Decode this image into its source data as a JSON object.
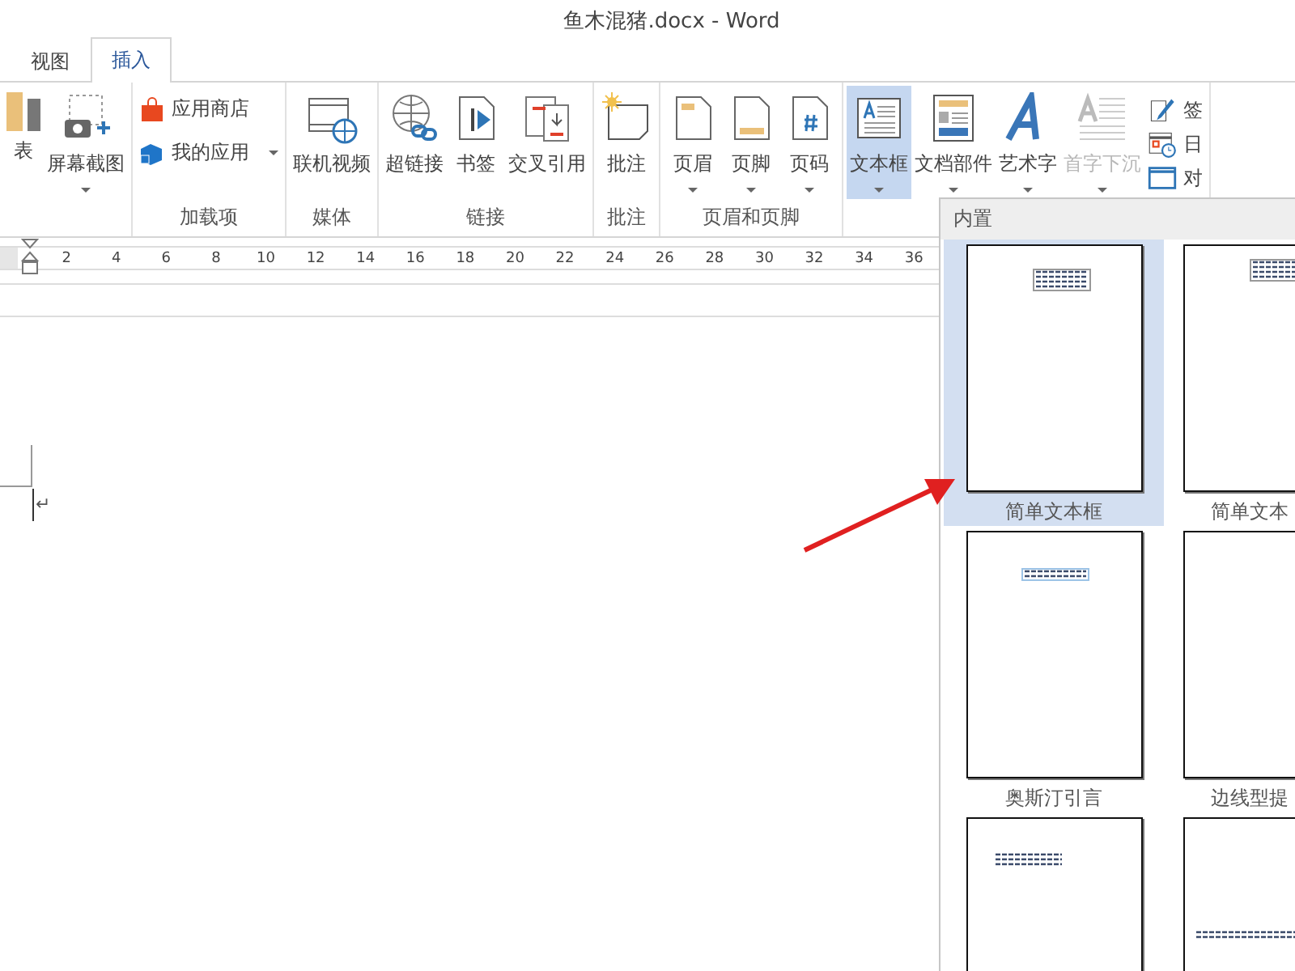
{
  "window": {
    "title": "鱼木混猪.docx - Word"
  },
  "tabs": [
    {
      "label": "视图",
      "selected": false
    },
    {
      "label": "插入",
      "selected": true
    }
  ],
  "ribbon": {
    "groups": [
      {
        "buttons": [
          {
            "kind": "large",
            "label": "表",
            "dropdown": false
          },
          {
            "kind": "large",
            "label": "屏幕截图",
            "dropdown": true
          }
        ]
      },
      {
        "label": "加载项",
        "buttons": [
          {
            "kind": "small",
            "label": "应用商店",
            "dropdown": false
          },
          {
            "kind": "small",
            "label": "我的应用",
            "dropdown": true
          }
        ]
      },
      {
        "label": "媒体",
        "buttons": [
          {
            "kind": "large",
            "label": "联机视频",
            "dropdown": false
          }
        ]
      },
      {
        "label": "链接",
        "buttons": [
          {
            "kind": "large",
            "label": "超链接",
            "dropdown": false
          },
          {
            "kind": "large",
            "label": "书签",
            "dropdown": false
          },
          {
            "kind": "large",
            "label": "交叉引用",
            "dropdown": false
          }
        ]
      },
      {
        "label": "批注",
        "buttons": [
          {
            "kind": "large",
            "label": "批注",
            "dropdown": false
          }
        ]
      },
      {
        "label": "页眉和页脚",
        "buttons": [
          {
            "kind": "large",
            "label": "页眉",
            "dropdown": true
          },
          {
            "kind": "large",
            "label": "页脚",
            "dropdown": true
          },
          {
            "kind": "large",
            "label": "页码",
            "dropdown": true
          }
        ]
      },
      {
        "buttons": [
          {
            "kind": "large",
            "label": "文本框",
            "dropdown": true,
            "pressed": true,
            "disabled": false
          },
          {
            "kind": "large",
            "label": "文档部件",
            "dropdown": true,
            "pressed": false,
            "disabled": false
          },
          {
            "kind": "large",
            "label": "艺术字",
            "dropdown": true,
            "pressed": false,
            "disabled": false
          },
          {
            "kind": "large",
            "label": "首字下沉",
            "dropdown": true,
            "pressed": false,
            "disabled": true
          },
          {
            "kind": "small",
            "label": "签",
            "dropdown": false,
            "pressed": false,
            "disabled": false
          },
          {
            "kind": "small",
            "label": "日",
            "dropdown": false,
            "pressed": false,
            "disabled": false
          },
          {
            "kind": "small",
            "label": "对",
            "dropdown": false,
            "pressed": false,
            "disabled": false
          }
        ]
      }
    ]
  },
  "ruler": {
    "ticks": [
      "2",
      "4",
      "6",
      "8",
      "10",
      "12",
      "14",
      "16",
      "18",
      "20",
      "22",
      "24",
      "26",
      "28",
      "30",
      "32",
      "34",
      "36"
    ]
  },
  "document": {
    "paragraph_mark": "↵"
  },
  "gallery": {
    "header": "内置",
    "items": [
      {
        "label": "简单文本框",
        "selected": true
      },
      {
        "label": "简单文本",
        "selected": false
      },
      {
        "label": "奥斯汀引言",
        "selected": false
      },
      {
        "label": "边线型提",
        "selected": false
      },
      {
        "selected": false
      },
      {
        "selected": false
      }
    ]
  }
}
